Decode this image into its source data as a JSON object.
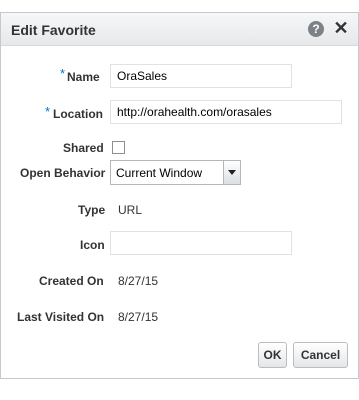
{
  "dialog": {
    "title": "Edit Favorite",
    "help_icon": "help-icon",
    "close_icon": "close-icon"
  },
  "form": {
    "required_marker": "*",
    "name_label": "Name",
    "name_value": "OraSales",
    "location_label": "Location",
    "location_value": "http://orahealth.com/orasales",
    "shared_label": "Shared",
    "shared_checked": false,
    "open_behavior_label": "Open Behavior",
    "open_behavior_value": "Current Window",
    "type_label": "Type",
    "type_value": "URL",
    "icon_label": "Icon",
    "icon_value": "",
    "created_on_label": "Created On",
    "created_on_value": "8/27/15",
    "last_visited_label": "Last Visited On",
    "last_visited_value": "8/27/15"
  },
  "buttons": {
    "ok_label": "OK",
    "cancel_label": "Cancel"
  },
  "colors": {
    "required": "#0572ce",
    "title_bar": "#e6e8ea"
  }
}
